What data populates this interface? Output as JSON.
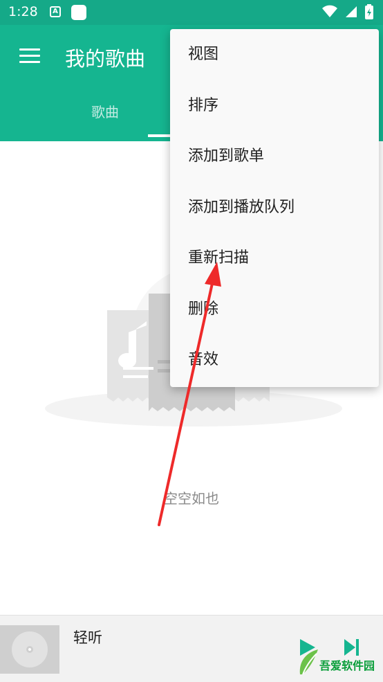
{
  "status_bar": {
    "time": "1:28",
    "notif_letter": "A"
  },
  "app_bar": {
    "title": "我的歌曲",
    "tabs": [
      {
        "label": "歌曲"
      }
    ]
  },
  "menu": {
    "items": [
      {
        "label": "视图"
      },
      {
        "label": "排序"
      },
      {
        "label": "添加到歌单"
      },
      {
        "label": "添加到播放队列"
      },
      {
        "label": "重新扫描"
      },
      {
        "label": "删除"
      },
      {
        "label": "音效"
      }
    ]
  },
  "empty_state": {
    "text": "空空如也"
  },
  "player": {
    "title": "轻听"
  },
  "watermark": {
    "text": "吾爱软件园"
  },
  "colors": {
    "primary": "#15b590",
    "status_bar": "#15a988",
    "arrow": "#ee2a2a"
  }
}
